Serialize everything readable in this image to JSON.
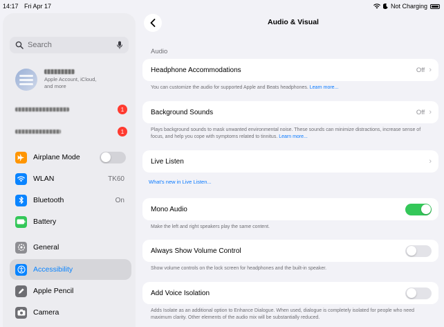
{
  "status_bar": {
    "time": "14:17",
    "date": "Fri Apr 17",
    "charging": "Not Charging"
  },
  "sidebar": {
    "search_placeholder": "Search",
    "account": {
      "subtitle_line1": "Apple Account, iCloud,",
      "subtitle_line2": "and more"
    },
    "badges": [
      "1",
      "1"
    ],
    "items": [
      {
        "label": "Airplane Mode",
        "icon": "airplane-icon",
        "color": "#ff9500"
      },
      {
        "label": "WLAN",
        "value": "TK60",
        "icon": "wifi-icon",
        "color": "#0a84ff"
      },
      {
        "label": "Bluetooth",
        "value": "On",
        "icon": "bluetooth-icon",
        "color": "#0a84ff"
      },
      {
        "label": "Battery",
        "icon": "battery-icon",
        "color": "#34c759"
      },
      {
        "label": "General",
        "icon": "gear-icon",
        "color": "#8e8e93"
      },
      {
        "label": "Accessibility",
        "icon": "accessibility-icon",
        "color": "#0a84ff"
      },
      {
        "label": "Apple Pencil",
        "icon": "pencil-icon",
        "color": "#6e6e73"
      },
      {
        "label": "Camera",
        "icon": "camera-icon",
        "color": "#6e6e73"
      }
    ]
  },
  "main": {
    "title": "Audio & Visual",
    "section_header": "Audio",
    "rows": [
      {
        "label": "Headphone Accommodations",
        "value": "Off",
        "footnote": "You can customize the audio for supported Apple and Beats headphones.",
        "link": "Learn more..."
      },
      {
        "label": "Background Sounds",
        "value": "Off",
        "footnote": "Plays background sounds to mask unwanted environmental noise. These sounds can minimize distractions, increase sense of focus, and help you cope with symptoms related to tinnitus.",
        "link": "Learn more..."
      },
      {
        "label": "Live Listen",
        "link_below": "What's new in Live Listen..."
      },
      {
        "label": "Mono Audio",
        "toggle": true,
        "footnote": "Make the left and right speakers play the same content."
      },
      {
        "label": "Always Show Volume Control",
        "toggle": false,
        "footnote": "Show volume controls on the lock screen for headphones and the built-in speaker."
      },
      {
        "label": "Add Voice Isolation",
        "toggle": false,
        "footnote": "Adds Isolate as an additional option to Enhance Dialogue. When used, dialogue is completely isolated for people who need maximum clarity. Other elements of the audio mix will be substantially reduced."
      }
    ]
  }
}
